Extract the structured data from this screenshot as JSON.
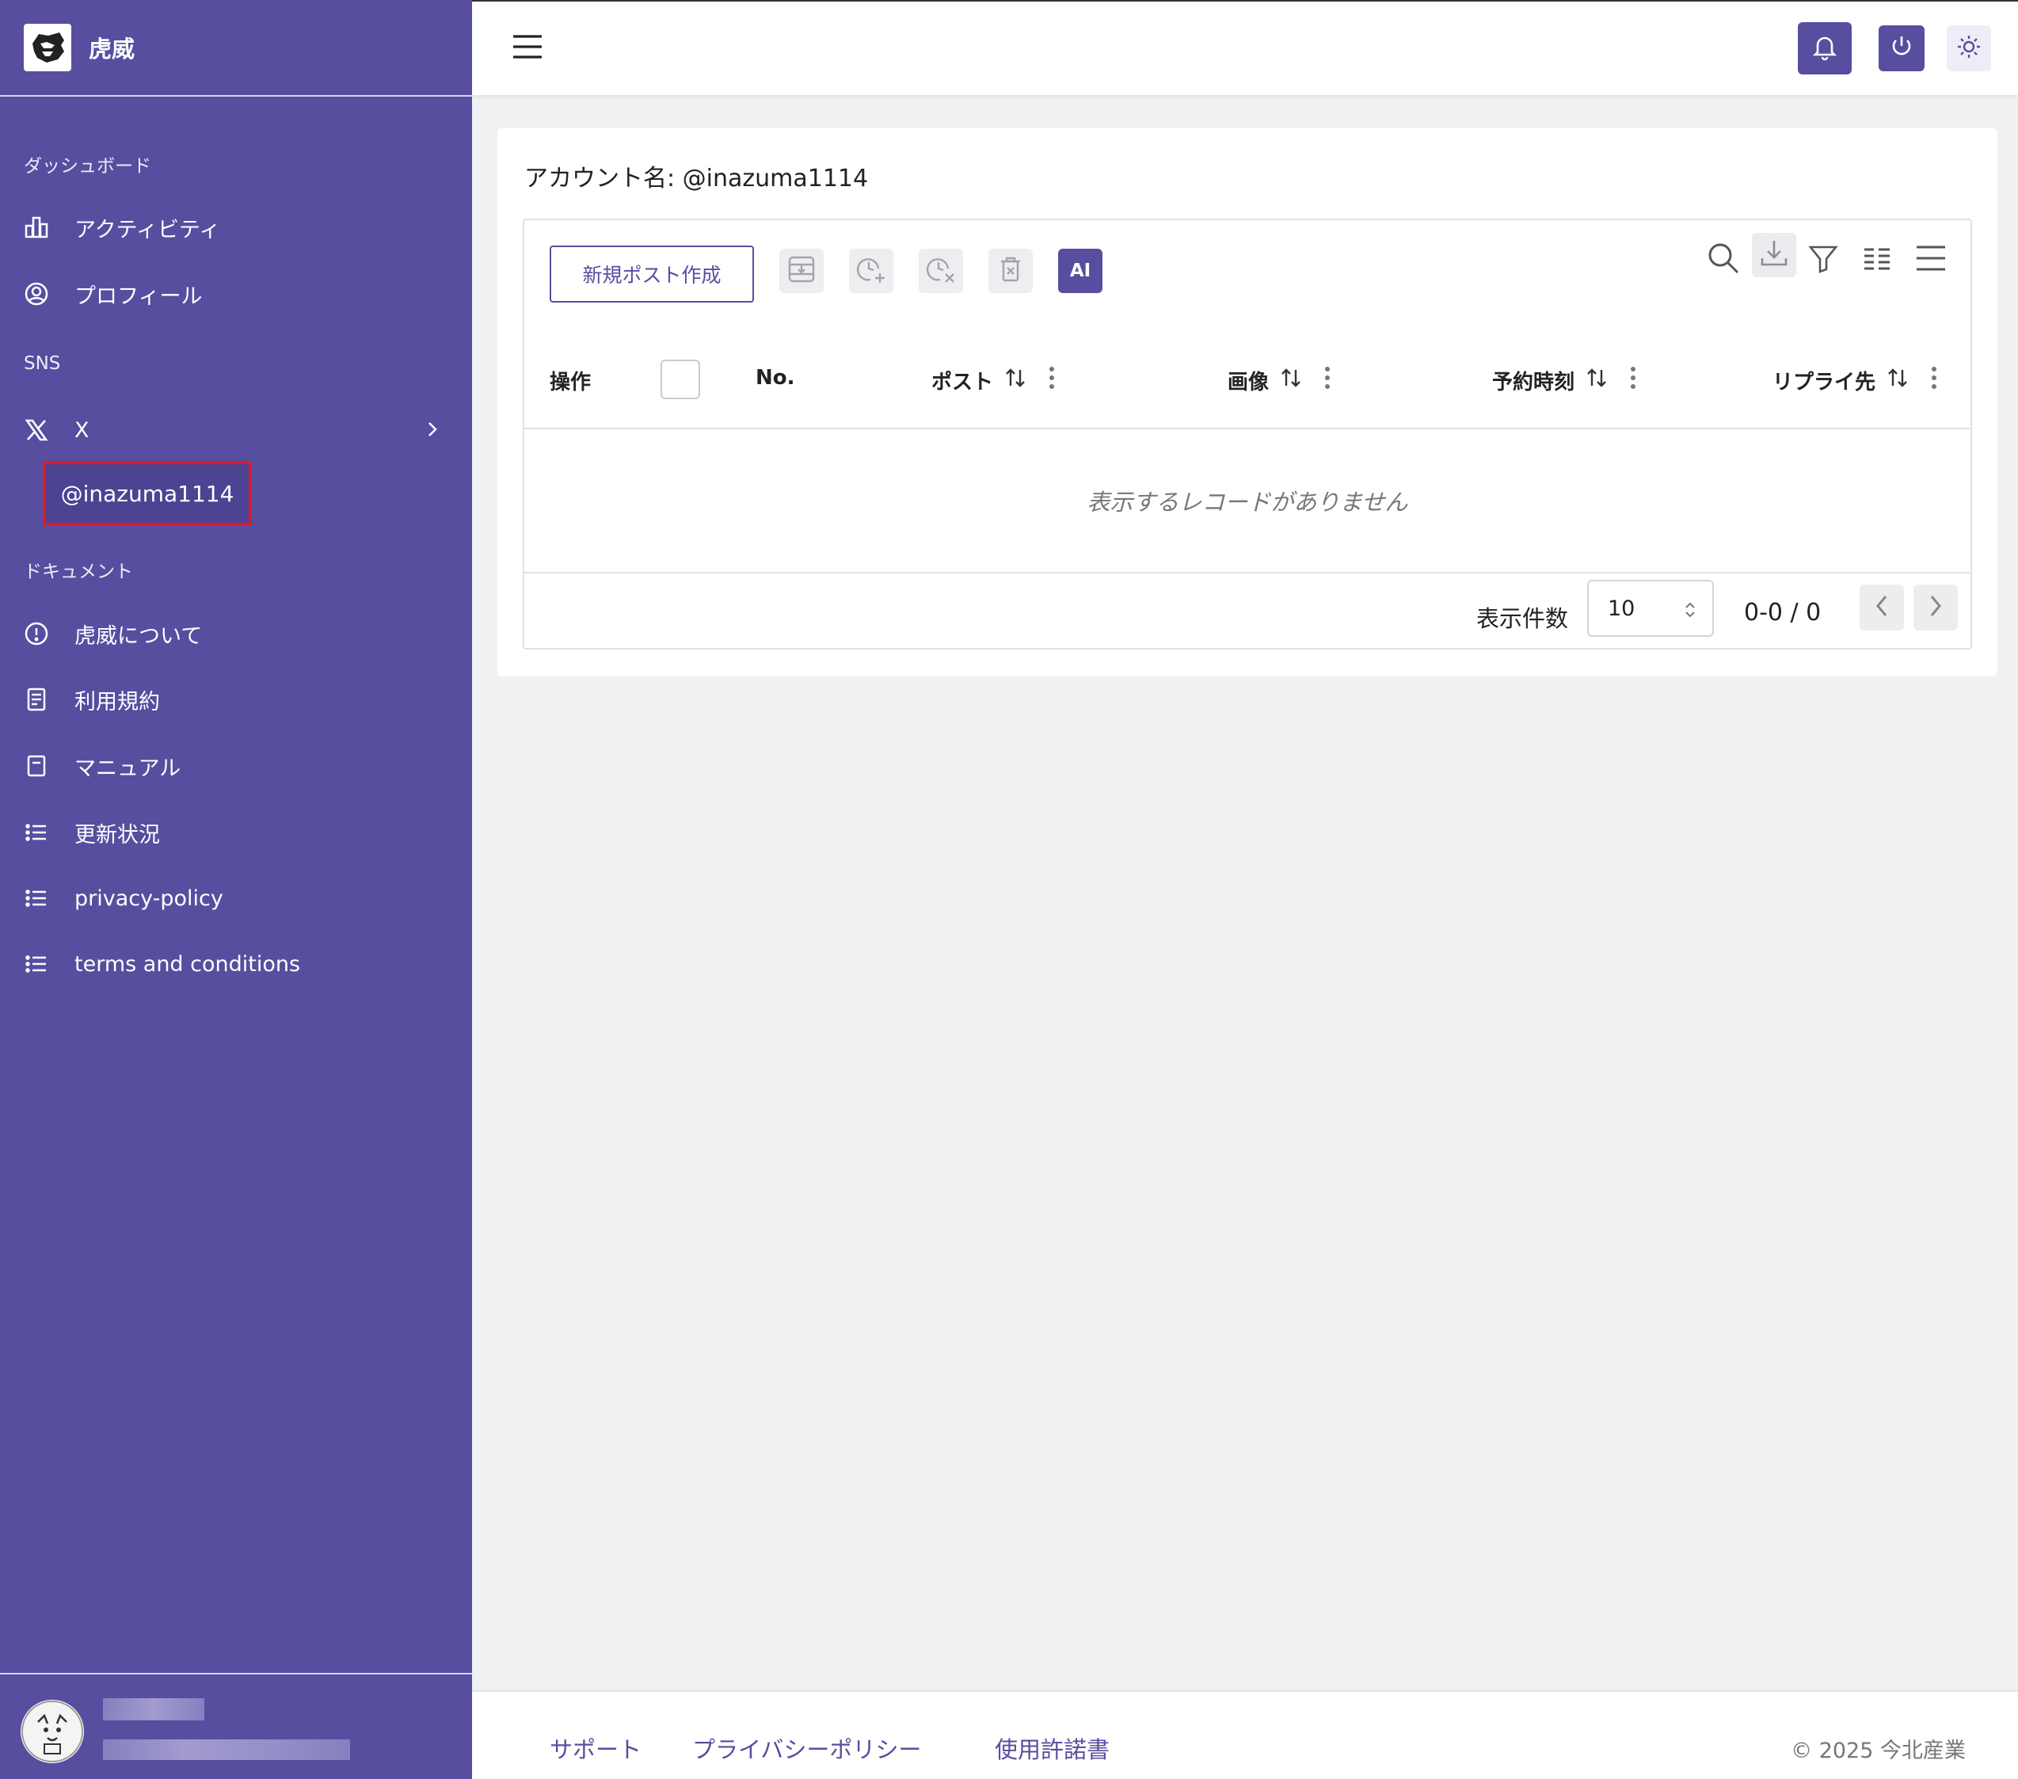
{
  "brand": {
    "name": "虎威"
  },
  "sidebar": {
    "sections": {
      "dashboard": "ダッシュボード",
      "sns": "SNS",
      "documents": "ドキュメント"
    },
    "items": {
      "activity": "アクティビティ",
      "profile": "プロフィール",
      "x": "X",
      "x_account": "@inazuma1114",
      "about": "虎威について",
      "terms_jp": "利用規約",
      "manual": "マニュアル",
      "updates": "更新状況",
      "privacy": "privacy-policy",
      "terms_en": "terms and conditions"
    }
  },
  "topbar": {
    "icons": [
      "menu-icon",
      "bell-icon",
      "power-icon",
      "sun-icon"
    ]
  },
  "main": {
    "account_label": "アカウント名: @inazuma1114",
    "new_post_button": "新規ポスト作成",
    "ai_button": "AI",
    "columns": {
      "ops": "操作",
      "no": "No.",
      "post": "ポスト",
      "image": "画像",
      "schedule": "予約時刻",
      "reply": "リプライ先"
    },
    "empty_message": "表示するレコードがありません",
    "pager": {
      "label": "表示件数",
      "page_size": "10",
      "range": "0-0 / 0"
    }
  },
  "footer": {
    "support": "サポート",
    "privacy": "プライバシーポリシー",
    "license": "使用許諾書",
    "copyright": "© 2025 今北産業"
  },
  "colors": {
    "sidebar": "#574ea0",
    "accent": "#574ea0",
    "highlight_border": "#d91c2a"
  }
}
